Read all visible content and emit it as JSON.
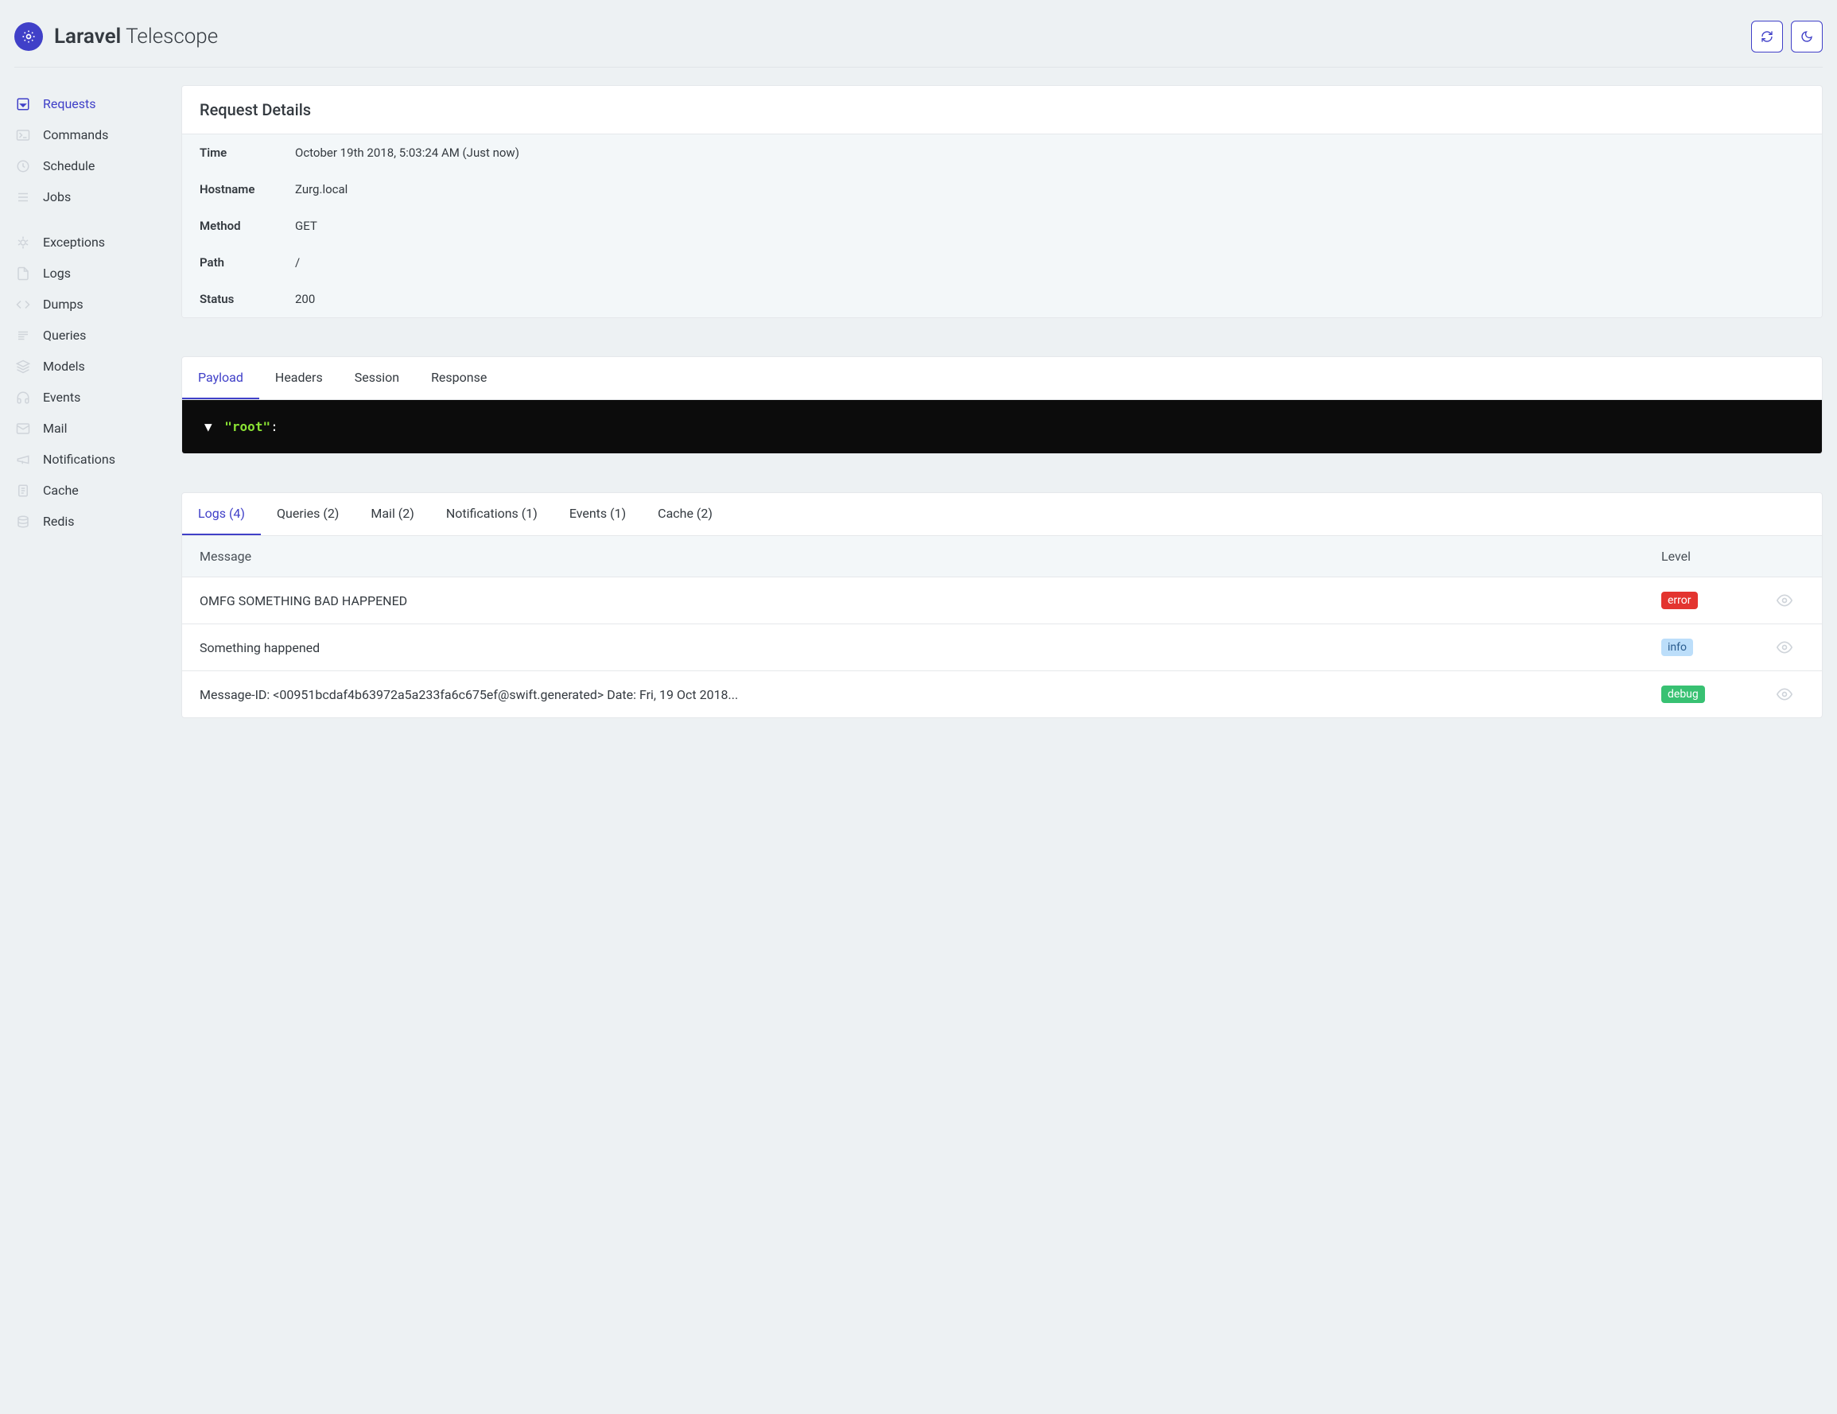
{
  "brand": {
    "bold": "Laravel",
    "light": " Telescope"
  },
  "sidebar": {
    "group1": [
      {
        "label": "Requests",
        "icon": "request",
        "active": true
      },
      {
        "label": "Commands",
        "icon": "terminal"
      },
      {
        "label": "Schedule",
        "icon": "clock"
      },
      {
        "label": "Jobs",
        "icon": "list"
      }
    ],
    "group2": [
      {
        "label": "Exceptions",
        "icon": "bug"
      },
      {
        "label": "Logs",
        "icon": "file"
      },
      {
        "label": "Dumps",
        "icon": "code"
      },
      {
        "label": "Queries",
        "icon": "lines"
      },
      {
        "label": "Models",
        "icon": "layers"
      },
      {
        "label": "Events",
        "icon": "headphones"
      },
      {
        "label": "Mail",
        "icon": "mail"
      },
      {
        "label": "Notifications",
        "icon": "megaphone"
      },
      {
        "label": "Cache",
        "icon": "doc"
      },
      {
        "label": "Redis",
        "icon": "stack"
      }
    ]
  },
  "card": {
    "title": "Request Details",
    "rows": [
      {
        "label": "Time",
        "value": "October 19th 2018, 5:03:24 AM (Just now)"
      },
      {
        "label": "Hostname",
        "value": "Zurg.local"
      },
      {
        "label": "Method",
        "value": "GET"
      },
      {
        "label": "Path",
        "value": "/"
      },
      {
        "label": "Status",
        "value": "200"
      }
    ]
  },
  "payloadTabs": [
    {
      "label": "Payload",
      "active": true
    },
    {
      "label": "Headers"
    },
    {
      "label": "Session"
    },
    {
      "label": "Response"
    }
  ],
  "payload": {
    "rootKey": "\"root\""
  },
  "relatedTabs": [
    {
      "label": "Logs (4)",
      "active": true
    },
    {
      "label": "Queries (2)"
    },
    {
      "label": "Mail (2)"
    },
    {
      "label": "Notifications (1)"
    },
    {
      "label": "Events (1)"
    },
    {
      "label": "Cache (2)"
    }
  ],
  "logsTable": {
    "headers": {
      "message": "Message",
      "level": "Level"
    },
    "rows": [
      {
        "message": "OMFG SOMETHING BAD HAPPENED",
        "level": "error"
      },
      {
        "message": "Something happened",
        "level": "info"
      },
      {
        "message": "Message-ID: <00951bcdaf4b63972a5a233fa6c675ef@swift.generated> Date: Fri, 19 Oct 2018...",
        "level": "debug"
      }
    ]
  }
}
